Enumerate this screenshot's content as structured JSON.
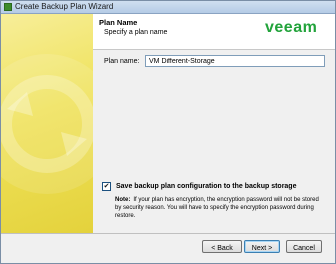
{
  "window": {
    "title": "Create Backup Plan Wizard"
  },
  "header": {
    "title": "Plan Name",
    "subtitle": "Specify a plan name",
    "logo_text": "veeam"
  },
  "form": {
    "name_label": "Plan name:",
    "name_value": "VM Different-Storage"
  },
  "save_config": {
    "checked": true,
    "label": "Save backup plan configuration to the backup storage",
    "note_label": "Note:",
    "note_text": "If your plan has encryption, the encryption password will not be stored by security reason. You will have to specify the encryption password during restore."
  },
  "buttons": {
    "back": "< Back",
    "next": "Next >",
    "cancel": "Cancel"
  },
  "colors": {
    "accent_green": "#22a33b",
    "sidebar_yellow": "#efe25a",
    "titlebar": "#b5cbe6"
  }
}
